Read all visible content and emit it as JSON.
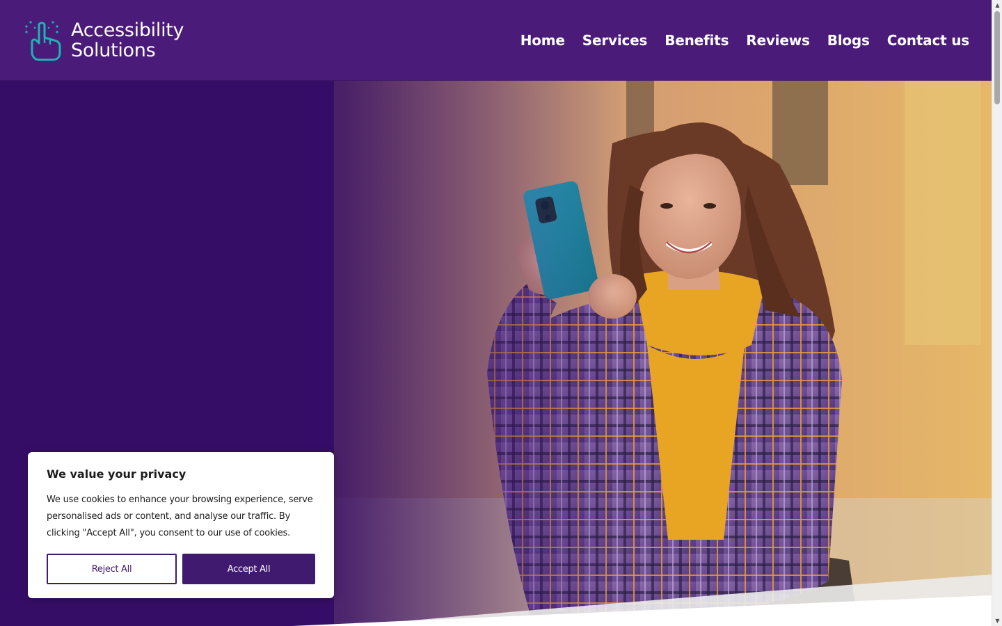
{
  "brand": {
    "name_line1": "Accessibility",
    "name_line2": "Solutions",
    "logo_icon": "pointing-hand-icon"
  },
  "nav": {
    "items": [
      {
        "label": "Home"
      },
      {
        "label": "Services"
      },
      {
        "label": "Benefits"
      },
      {
        "label": "Reviews"
      },
      {
        "label": "Blogs"
      },
      {
        "label": "Contact us"
      }
    ]
  },
  "hero": {
    "image_alt": "Smiling woman in a wheelchair taking a selfie with a phone"
  },
  "cookie_banner": {
    "title": "We value your privacy",
    "text": "We use cookies to enhance your browsing experience, serve personalised ads or content, and analyse our traffic. By clicking \"Accept All\", you consent to our use of cookies.",
    "reject_label": "Reject All",
    "accept_label": "Accept All"
  },
  "colors": {
    "header_bg": "#4a1b78",
    "hero_bg": "#360d66",
    "logo_accent": "#1fb3b4",
    "button_primary": "#3f1a6e"
  }
}
